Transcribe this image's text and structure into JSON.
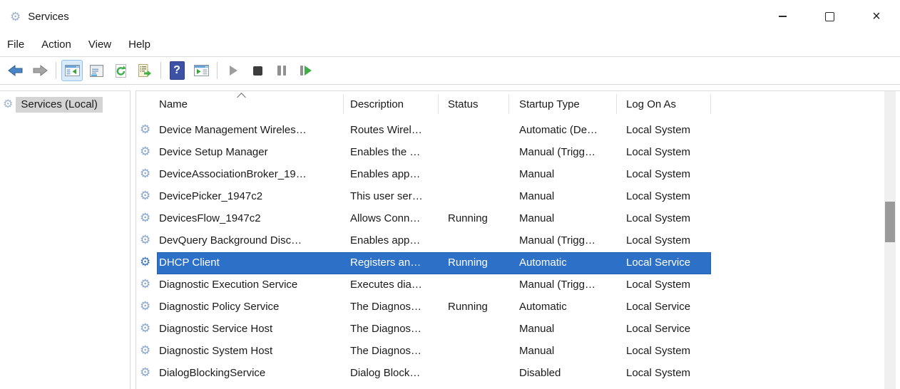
{
  "window": {
    "title": "Services"
  },
  "menu": {
    "items": [
      {
        "label": "File"
      },
      {
        "label": "Action"
      },
      {
        "label": "View"
      },
      {
        "label": "Help"
      }
    ]
  },
  "toolbar": {
    "help_glyph": "?",
    "buttons": [
      {
        "name": "back",
        "icon": "arrow-left-icon"
      },
      {
        "name": "forward",
        "icon": "arrow-right-icon"
      },
      {
        "name": "show-hide-console-tree",
        "icon": "window-tree-icon",
        "active": true
      },
      {
        "name": "properties",
        "icon": "window-list-icon"
      },
      {
        "name": "refresh",
        "icon": "refresh-icon"
      },
      {
        "name": "export-list",
        "icon": "document-export-icon"
      },
      {
        "name": "help",
        "icon": "question-mark-icon"
      },
      {
        "name": "show-hide-action-pane",
        "icon": "window-play-icon"
      },
      {
        "name": "start-service",
        "icon": "play-icon"
      },
      {
        "name": "stop-service",
        "icon": "stop-icon"
      },
      {
        "name": "pause-service",
        "icon": "pause-icon"
      },
      {
        "name": "restart-service",
        "icon": "restart-icon"
      }
    ]
  },
  "sidebar": {
    "items": [
      {
        "label": "Services (Local)",
        "selected": true
      }
    ]
  },
  "table": {
    "columns": [
      {
        "label": "Name",
        "sort": "asc"
      },
      {
        "label": "Description"
      },
      {
        "label": "Status"
      },
      {
        "label": "Startup Type"
      },
      {
        "label": "Log On As"
      }
    ],
    "rows": [
      {
        "name": "Device Management Wireles…",
        "description": "Routes Wirel…",
        "status": "",
        "startup_type": "Automatic (De…",
        "log_on_as": "Local System",
        "selected": false
      },
      {
        "name": "Device Setup Manager",
        "description": "Enables the …",
        "status": "",
        "startup_type": "Manual (Trigg…",
        "log_on_as": "Local System",
        "selected": false
      },
      {
        "name": "DeviceAssociationBroker_19…",
        "description": "Enables app…",
        "status": "",
        "startup_type": "Manual",
        "log_on_as": "Local System",
        "selected": false
      },
      {
        "name": "DevicePicker_1947c2",
        "description": "This user ser…",
        "status": "",
        "startup_type": "Manual",
        "log_on_as": "Local System",
        "selected": false
      },
      {
        "name": "DevicesFlow_1947c2",
        "description": "Allows Conn…",
        "status": "Running",
        "startup_type": "Manual",
        "log_on_as": "Local System",
        "selected": false
      },
      {
        "name": "DevQuery Background Disc…",
        "description": "Enables app…",
        "status": "",
        "startup_type": "Manual (Trigg…",
        "log_on_as": "Local System",
        "selected": false
      },
      {
        "name": "DHCP Client",
        "description": "Registers an…",
        "status": "Running",
        "startup_type": "Automatic",
        "log_on_as": "Local Service",
        "selected": true
      },
      {
        "name": "Diagnostic Execution Service",
        "description": "Executes dia…",
        "status": "",
        "startup_type": "Manual (Trigg…",
        "log_on_as": "Local System",
        "selected": false
      },
      {
        "name": "Diagnostic Policy Service",
        "description": "The Diagnos…",
        "status": "Running",
        "startup_type": "Automatic",
        "log_on_as": "Local Service",
        "selected": false
      },
      {
        "name": "Diagnostic Service Host",
        "description": "The Diagnos…",
        "status": "",
        "startup_type": "Manual",
        "log_on_as": "Local Service",
        "selected": false
      },
      {
        "name": "Diagnostic System Host",
        "description": "The Diagnos…",
        "status": "",
        "startup_type": "Manual",
        "log_on_as": "Local System",
        "selected": false
      },
      {
        "name": "DialogBlockingService",
        "description": "Dialog Block…",
        "status": "",
        "startup_type": "Disabled",
        "log_on_as": "Local System",
        "selected": false
      }
    ]
  },
  "scrollbar": {
    "orientation": "vertical"
  },
  "colors": {
    "selection_bg": "#2d70c8",
    "selection_border": "#2060ae",
    "sidebar_selected_bg": "#d4d4d4",
    "toolbar_active_bg": "#d9eafb",
    "toolbar_active_border": "#94c1ea",
    "gear_icon": "#8ba8cb",
    "gear_icon_selected": "#3c74be"
  }
}
